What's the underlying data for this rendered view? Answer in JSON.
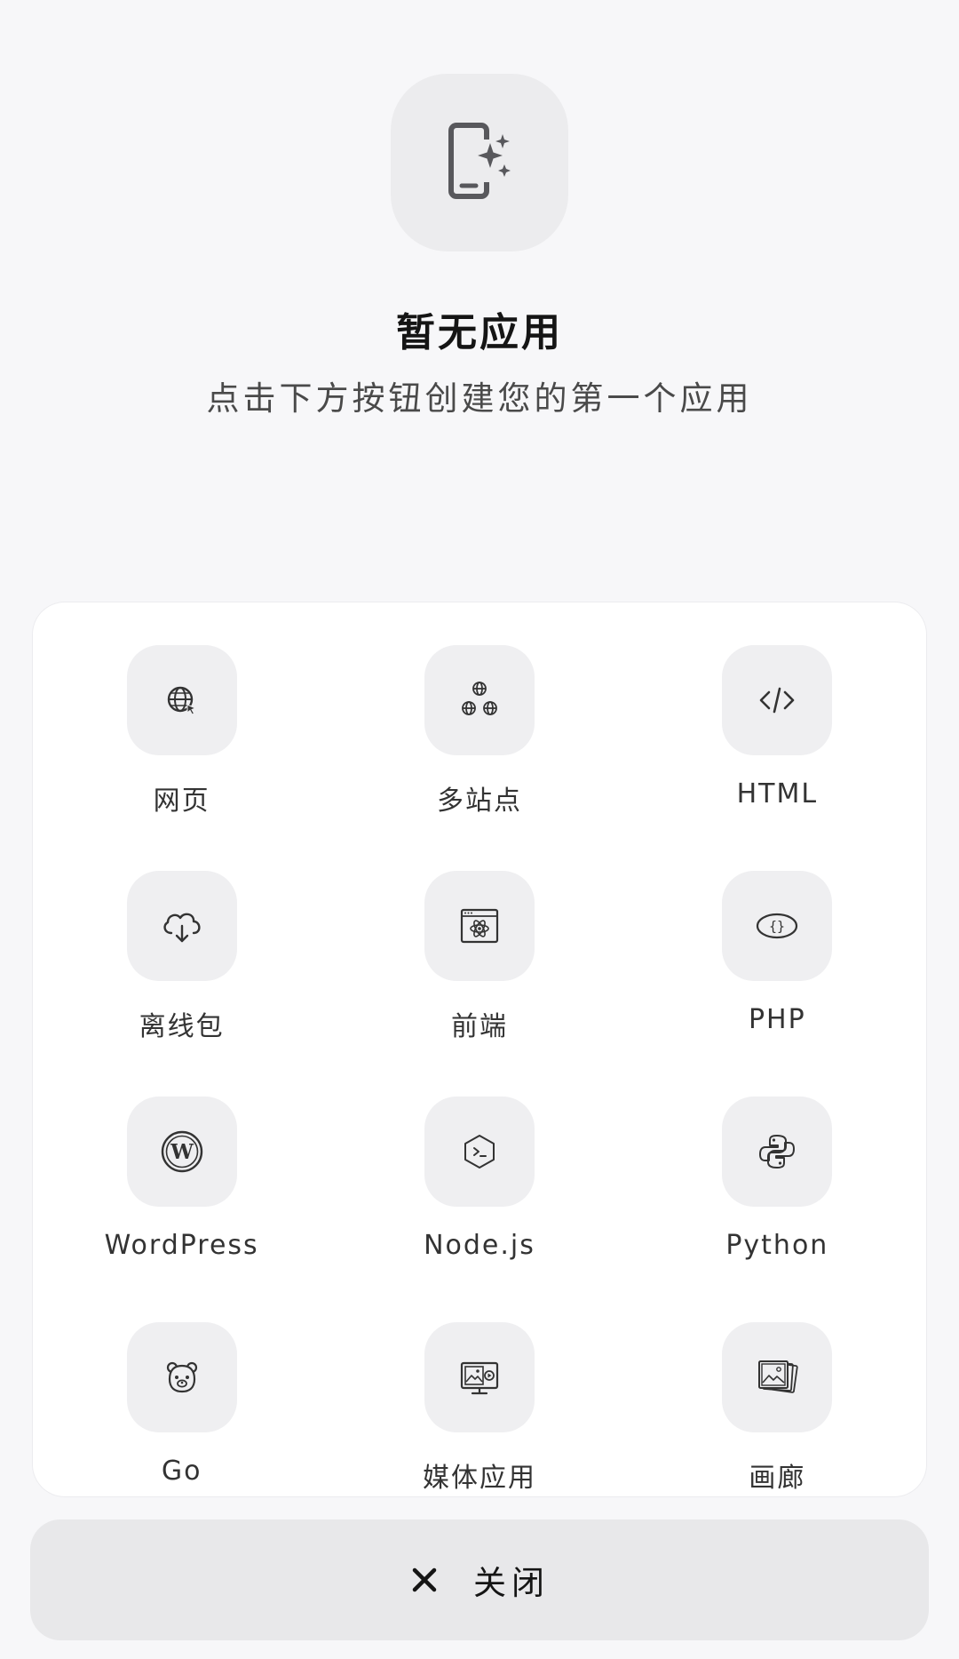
{
  "empty_state": {
    "icon": "mobile-sparkle-icon",
    "title": "暂无应用",
    "subtitle": "点击下方按钮创建您的第一个应用"
  },
  "templates": [
    {
      "label": "网页",
      "icon": "globe-cursor-icon"
    },
    {
      "label": "多站点",
      "icon": "multi-globe-icon"
    },
    {
      "label": "HTML",
      "icon": "code-brackets-icon"
    },
    {
      "label": "离线包",
      "icon": "cloud-download-icon"
    },
    {
      "label": "前端",
      "icon": "react-window-icon"
    },
    {
      "label": "PHP",
      "icon": "php-braces-icon"
    },
    {
      "label": "WordPress",
      "icon": "wordpress-icon"
    },
    {
      "label": "Node.js",
      "icon": "nodejs-hexagon-icon"
    },
    {
      "label": "Python",
      "icon": "python-icon"
    },
    {
      "label": "Go",
      "icon": "gopher-icon"
    },
    {
      "label": "媒体应用",
      "icon": "media-monitor-icon"
    },
    {
      "label": "画廊",
      "icon": "gallery-icon"
    }
  ],
  "close_button": {
    "label": "关闭",
    "icon": "close-icon"
  },
  "colors": {
    "background": "#f7f7f9",
    "sheet": "#ffffff",
    "tile": "#efeff1",
    "icon_stroke": "#333333",
    "hero_icon": "#58585c"
  }
}
